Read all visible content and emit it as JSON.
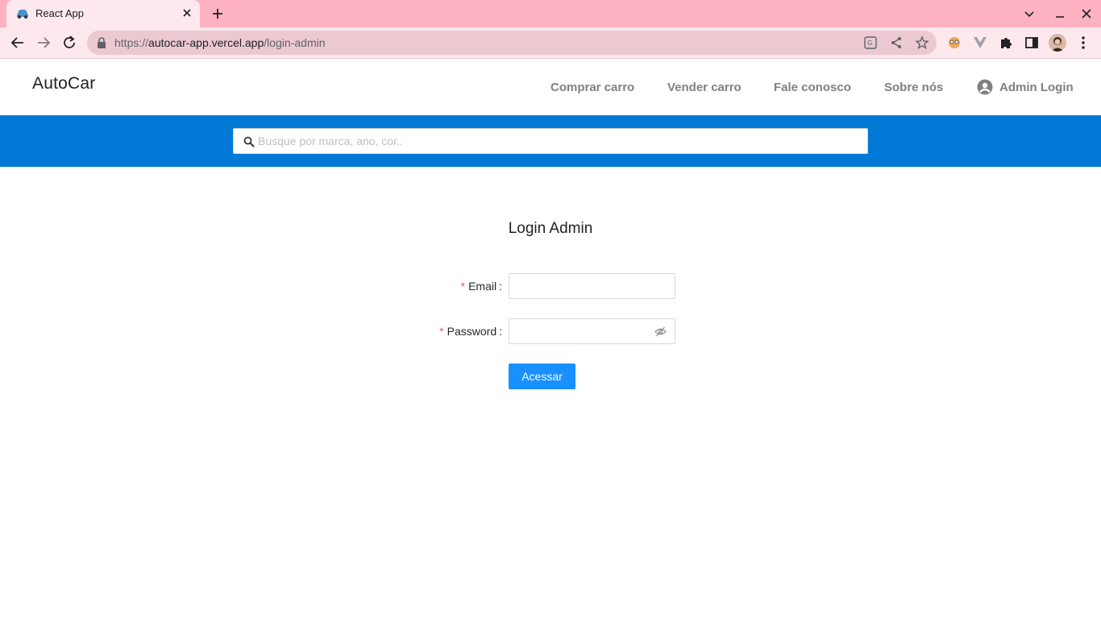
{
  "browser": {
    "tab_title": "React App",
    "url_scheme": "https://",
    "url_host": "autocar-app.vercel.app",
    "url_path": "/login-admin",
    "tab_bar_color": "#fdb1c1",
    "toolbar_color": "#fde8ed"
  },
  "header": {
    "logo": "AutoCar",
    "nav": [
      {
        "label": "Comprar carro"
      },
      {
        "label": "Vender carro"
      },
      {
        "label": "Fale conosco"
      },
      {
        "label": "Sobre nós"
      }
    ],
    "admin_login": "Admin Login"
  },
  "search": {
    "placeholder": "Busque por marca, ano, cor..",
    "band_color": "#0079d7"
  },
  "login": {
    "title": "Login Admin",
    "email_label": "Email",
    "password_label": "Password",
    "required_mark": "*",
    "colon": ":",
    "email_value": "",
    "password_value": "",
    "submit_label": "Acessar",
    "primary_color": "#1890ff"
  }
}
